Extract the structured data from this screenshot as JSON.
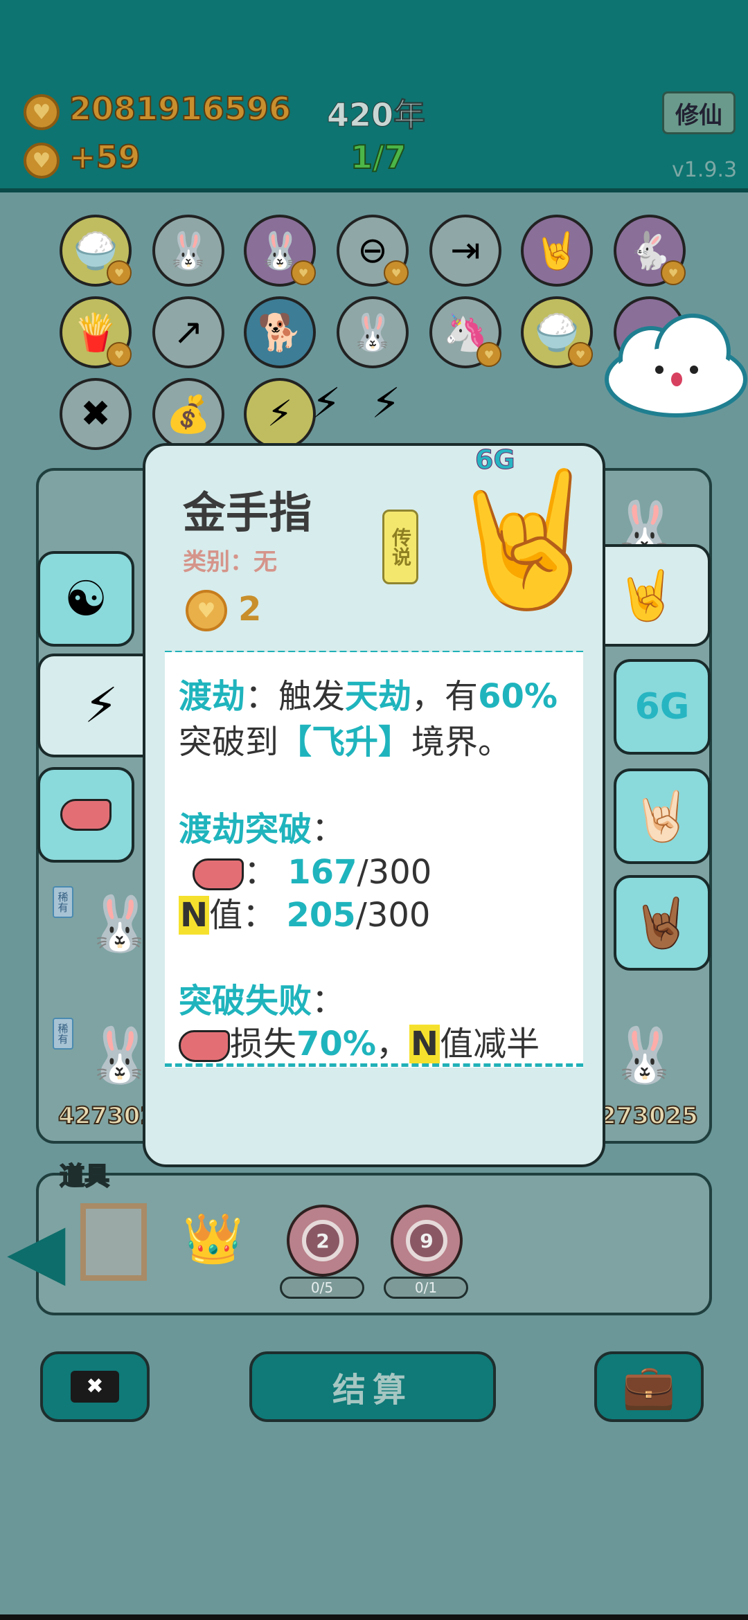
{
  "header": {
    "coins": "2081916596",
    "income": "+59",
    "year": "420年",
    "round": "1/7",
    "cultivate_button": "修仙",
    "version": "v1.9.3"
  },
  "colors": {
    "topbar": "#0d7471",
    "accent_teal": "#1fb4bd",
    "card_bg": "#d7ecec",
    "coin": "#c88f2c"
  },
  "icons": {
    "row1": [
      "rice-bowl-icon",
      "twin-rabbits-icon",
      "twin-rabbits-icon",
      "minus-icon",
      "skip-icon",
      "rock-hand-icon",
      "rabbit-icon"
    ],
    "row2": [
      "fries-icon",
      "arrow-card-icon",
      "dog-with-glasses-icon",
      "twin-rabbits-icon",
      "unicorn-icon",
      "rice-bowl-icon",
      "hidden-icon"
    ],
    "row3": [
      "discard-tag-icon",
      "money-bag-icon",
      "lightning-icon"
    ]
  },
  "card": {
    "title": "金手指",
    "type_label": "类别：无",
    "rarity": "传说",
    "cost": "2",
    "tag": "6G",
    "desc": {
      "line1_key": "渡劫",
      "line1_a": "：触发",
      "line1_b": "天劫",
      "line1_c": "，有",
      "line1_d": "60%",
      "line2_a": "突破到",
      "line2_b": "【飞升】",
      "line2_c": "境界。",
      "section2": "渡劫突破",
      "colon": "：",
      "liver_cur": "167",
      "liver_max": "/300",
      "n_label": "N",
      "n_suffix": "值：",
      "n_cur": "205",
      "n_max": "/300",
      "section3": "突破失败",
      "fail_a": "损失",
      "fail_b": "70%",
      "fail_c": "，",
      "fail_n": "N",
      "fail_d": "值减半"
    }
  },
  "left_tabs": [
    "yin-yang-icon",
    "lightning-icon",
    "liver-icon"
  ],
  "right_tabs": [
    "rock-hand-yellow-icon",
    "6G",
    "rock-hand-white-icon",
    "rock-hand-brown-icon"
  ],
  "rabbits": {
    "rare_label": "稀有",
    "left_bottom_num": "427302",
    "right_bottom_num": "273025"
  },
  "props": {
    "label": "道具",
    "target1": "2",
    "target1_count": "0/5",
    "target2": "9",
    "target2_count": "0/1"
  },
  "bottom": {
    "settle": "结算"
  }
}
